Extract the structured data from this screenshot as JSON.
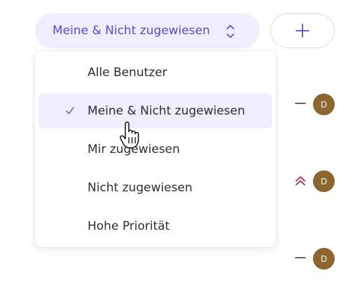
{
  "filter": {
    "selected_label": "Meine & Nicht zugewiesen",
    "icon": "chevron-up-down-icon"
  },
  "add_button": {
    "icon": "plus-icon"
  },
  "menu": {
    "items": [
      {
        "label": "Alle Benutzer",
        "selected": false
      },
      {
        "label": "Meine & Nicht zugewiesen",
        "selected": true
      },
      {
        "label": "Mir zugewiesen",
        "selected": false
      },
      {
        "label": "Nicht zugewiesen",
        "selected": false
      },
      {
        "label": "Hohe Priorität",
        "selected": false
      }
    ],
    "check_icon": "checkmark-icon"
  },
  "rows": [
    {
      "priority": "none",
      "priority_icon": "dash-icon",
      "avatar_initial": "D"
    },
    {
      "priority": "high",
      "priority_icon": "double-chevron-up-icon",
      "avatar_initial": "D"
    },
    {
      "priority": "none",
      "priority_icon": "dash-icon",
      "avatar_initial": "D"
    }
  ],
  "colors": {
    "accent": "#5b49d6",
    "accent_bg": "#eeeefe",
    "avatar": "#8e652c",
    "high_priority": "#b0243a"
  }
}
